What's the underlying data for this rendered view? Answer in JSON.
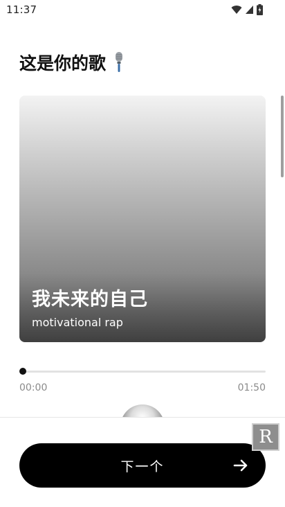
{
  "status_bar": {
    "time": "11:37",
    "icons": [
      "wifi-icon",
      "signal-icon",
      "battery-icon"
    ]
  },
  "page": {
    "title": "这是你的歌",
    "title_icon": "microphone-icon"
  },
  "song": {
    "title": "我未来的自己",
    "subtitle": "motivational rap"
  },
  "player": {
    "current_time": "00:00",
    "duration": "01:50",
    "progress": 0.0
  },
  "actions": {
    "next_label": "下一个",
    "next_icon": "arrow-right-icon"
  },
  "floating_badge": {
    "label": "R"
  },
  "colors": {
    "button_bg": "#000000",
    "text_primary": "#111111",
    "text_secondary": "#8a8a8a"
  }
}
